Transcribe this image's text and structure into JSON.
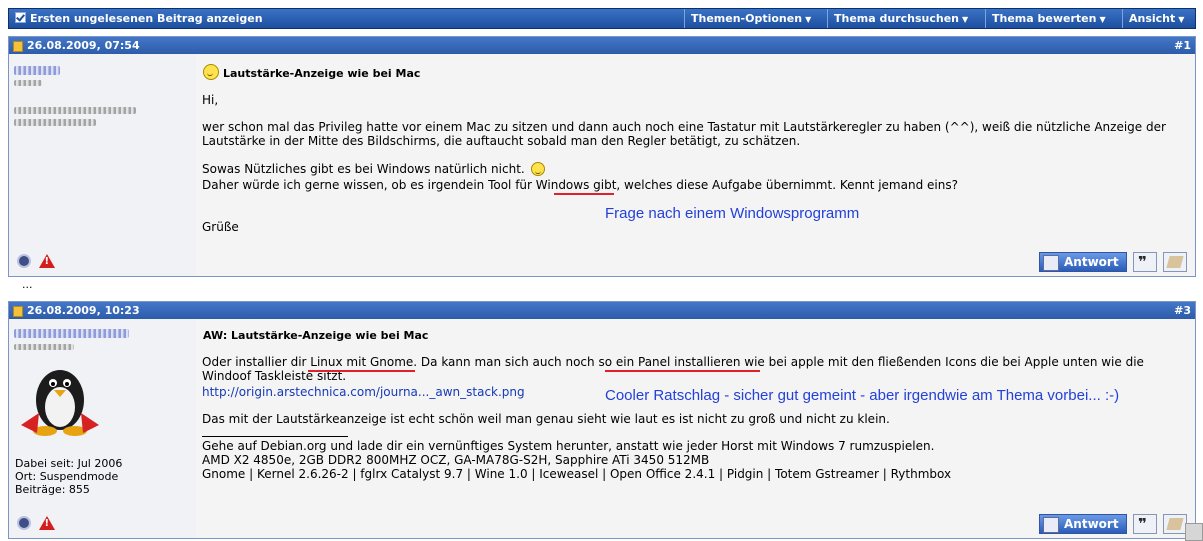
{
  "toolbar": {
    "first_unread": "Ersten ungelesenen Beitrag anzeigen",
    "thread_options": "Themen-Optionen",
    "search_thread": "Thema durchsuchen",
    "rate_thread": "Thema bewerten",
    "view": "Ansicht"
  },
  "posts": [
    {
      "date": "26.08.2009, 07:54",
      "number": "#1",
      "title": "Lautstärke-Anzeige wie bei Mac",
      "lines": [
        "Hi,",
        "wer schon mal das Privileg hatte vor einem Mac zu sitzen und dann auch noch eine Tastatur mit Lautstärkeregler zu haben (^^), weiß die nützliche Anzeige der Lautstärke in der Mitte des Bildschirms, die auftaucht sobald man den Regler betätigt, zu schätzen.",
        "Sowas Nützliches gibt es bei Windows natürlich nicht.",
        "Daher würde ich gerne wissen, ob es irgendein Tool für Windows gibt, welches diese Aufgabe übernimmt. Kennt jemand eins?",
        "Grüße"
      ],
      "annotation": "Frage nach einem Windowsprogramm",
      "reply_label": "Antwort"
    },
    {
      "date": "26.08.2009, 10:23",
      "number": "#3",
      "title": "AW: Lautstärke-Anzeige wie bei Mac",
      "lines": [
        "Oder installier dir Linux mit Gnome. Da kann man sich auch noch so ein Panel installieren wie bei apple mit den fließenden Icons die bei Apple unten wie die Windoof Taskleiste sitzt.",
        "http://origin.arstechnica.com/journa..._awn_stack.png",
        "Das mit der Lautstärkeanzeige ist echt schön weil man genau sieht wie laut es ist nicht zu groß und nicht zu klein."
      ],
      "signature": [
        "Gehe auf Debian.org und lade dir ein vernünftiges System herunter, anstatt wie jeder Horst mit Windows 7 rumzuspielen.",
        "AMD X2 4850e, 2GB DDR2 800MHZ OCZ, GA-MA78G-S2H, Sapphire ATi 3450 512MB",
        "Gnome | Kernel 2.6.26-2 | fglrx Catalyst 9.7 | Wine 1.0 | Iceweasel | Open Office 2.4.1 | Pidgin | Totem Gstreamer | Rythmbox"
      ],
      "user_info": {
        "joined": "Dabei seit: Jul 2006",
        "location": "Ort: Suspendmode",
        "posts": "Beiträge: 855"
      },
      "annotation": "Cooler Ratschlag - sicher gut gemeint - aber irgendwie am Thema vorbei... :-)",
      "reply_label": "Antwort"
    }
  ],
  "separator": "..."
}
